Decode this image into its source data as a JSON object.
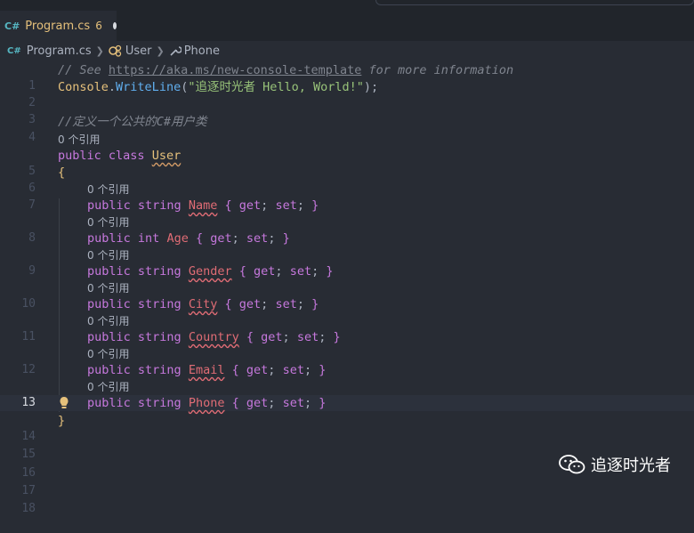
{
  "tab": {
    "icon": "csharp-icon",
    "icon_text": "C#",
    "label": "Program.cs",
    "problem_count": "6"
  },
  "breadcrumb": {
    "file_icon_text": "C#",
    "file": "Program.cs",
    "class": "User",
    "property": "Phone"
  },
  "editor": {
    "line_numbers": [
      "1",
      "2",
      "3",
      "4",
      "5",
      "6",
      "7",
      "8",
      "9",
      "10",
      "11",
      "12",
      "13",
      "14",
      "15",
      "16",
      "17",
      "18"
    ],
    "active_line": "13",
    "line1": {
      "prefix": "// See ",
      "url": "https://aka.ms/new-console-template",
      "suffix": " for more information"
    },
    "line2": {
      "obj": "Console",
      "dot": ".",
      "method": "WriteLine",
      "open": "(",
      "string": "\"追逐时光者 Hello, World!\"",
      "close": ");"
    },
    "line4": {
      "comment": "//定义一个公共的C#用户类"
    },
    "code_lens": "0 个引用",
    "line5": {
      "kw1": "public",
      "kw2": "class",
      "name": "User"
    },
    "brace_open": "{",
    "brace_close": "}",
    "properties": [
      {
        "line": "7",
        "type": "string",
        "name": "Name"
      },
      {
        "line": "8",
        "type": "int",
        "name": "Age"
      },
      {
        "line": "9",
        "type": "string",
        "name": "Gender"
      },
      {
        "line": "10",
        "type": "string",
        "name": "City"
      },
      {
        "line": "11",
        "type": "string",
        "name": "Country"
      },
      {
        "line": "12",
        "type": "string",
        "name": "Email"
      },
      {
        "line": "13",
        "type": "string",
        "name": "Phone"
      }
    ],
    "kw_public": "public",
    "accessor_open": "{ ",
    "get": "get",
    "set": "set",
    "semi": ";",
    "accessor_close": " }"
  },
  "watermark": {
    "text": "追逐时光者"
  },
  "colors": {
    "background": "#282c34",
    "keyword": "#c678dd",
    "property": "#e06c75",
    "type": "#e5c07b",
    "string": "#98c379",
    "function": "#61afef",
    "comment": "#7f848e"
  }
}
